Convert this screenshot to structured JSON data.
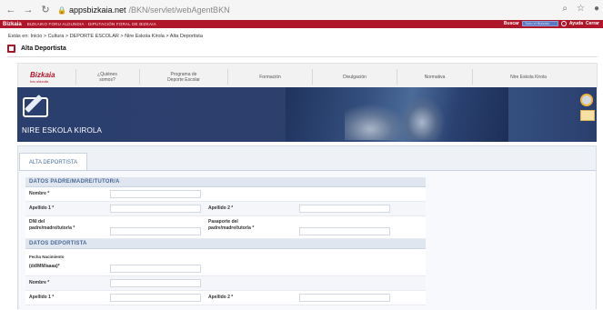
{
  "browser": {
    "url_host": "appsbizkaia.net",
    "url_path": "/BKN/servlet/webAgentBKN"
  },
  "topbar": {
    "logo": "Bizkaia",
    "links": "BIZKAIKO FORU ALDUNDIA · DIPUTACIÓN FORAL DE BIZKAIA",
    "search_label": "Buscar",
    "search_placeholder": "Todo el Bizkaia",
    "extra": "Ayuda",
    "close": "Cerrar"
  },
  "breadcrumb": "Estás en: Inicio > Cultura > DEPORTE ESCOLAR > Nire Eskola Kirola > Alta Deportista",
  "page": {
    "title": "Alta Deportista"
  },
  "menu": {
    "logo": "Bizkaia",
    "logo_sub": "foru aldundia",
    "items": [
      {
        "line1": "¿Quiénes",
        "line2": "somos?"
      },
      {
        "line1": "Programa de",
        "line2": "Deporte Escolar"
      },
      {
        "line1": "Formación",
        "line2": ""
      },
      {
        "line1": "Divulgación",
        "line2": ""
      },
      {
        "line1": "Normativa",
        "line2": ""
      },
      {
        "line1": "Nire Eskola Kirola",
        "line2": ""
      }
    ]
  },
  "hero": {
    "title": "NIRE ESKOLA KIROLA"
  },
  "form": {
    "tab": "ALTA DEPORTISTA",
    "sections": {
      "padre": "DATOS PADRE/MADRE/TUTOR/A",
      "deportista": "DATOS DEPORTISTA"
    },
    "labels": {
      "nombre": "Nombre *",
      "apellido1": "Apellido 1 *",
      "apellido2": "Apellido 2 *",
      "dni_line1": "DNI del",
      "dni_line2": "padre/madre/tutor/a *",
      "pasaporte_line1": "Pasaporte del",
      "pasaporte_line2": "padre/madre/tutor/a *",
      "fecha_line1": "Fecha Nacimiento",
      "fecha_line2": "(dd/MM/aaaa)*",
      "nombre_d": "Nombre *",
      "apellido1_d": "Apellido 1 *",
      "apellido2_d": "Apellido 2 *"
    }
  }
}
